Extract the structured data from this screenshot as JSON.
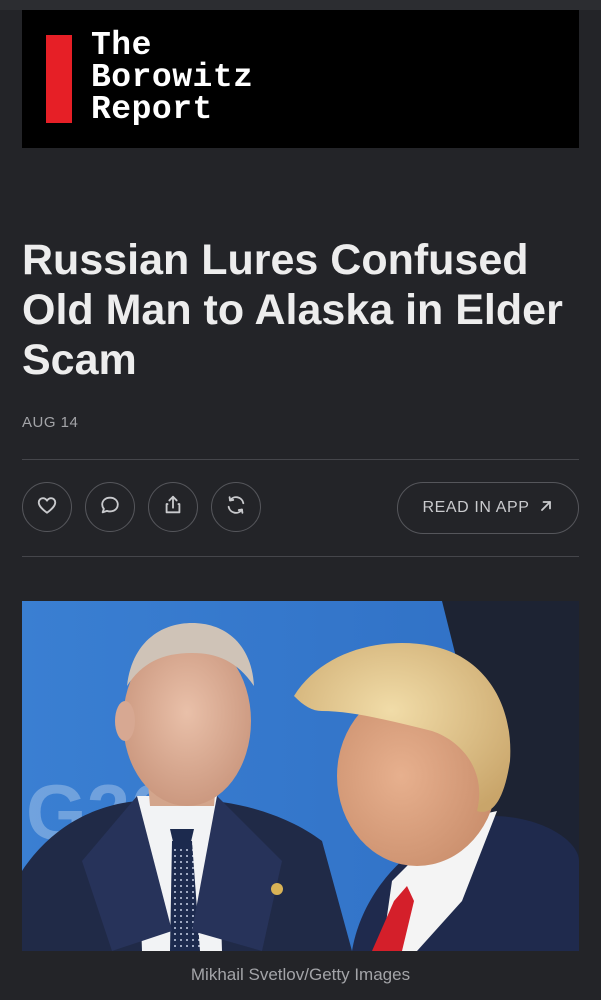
{
  "publication": {
    "logo_lines": [
      "The",
      "Borowitz",
      "Report"
    ],
    "accent_color": "#e61f26"
  },
  "article": {
    "headline": "Russian Lures Confused Old Man to Alaska in Elder Scam",
    "date": "AUG 14"
  },
  "actions": {
    "like_icon": "heart-icon",
    "comment_icon": "comment-icon",
    "share_icon": "share-icon",
    "restack_icon": "restack-icon",
    "read_in_app_label": "READ IN APP",
    "read_in_app_icon": "arrow-up-right-icon"
  },
  "photo": {
    "caption": "Mikhail Svetlov/Getty Images",
    "backdrop_text": "G20"
  },
  "colors": {
    "background": "#232428",
    "text_primary": "#ededed",
    "text_secondary": "#a3a4a8"
  }
}
